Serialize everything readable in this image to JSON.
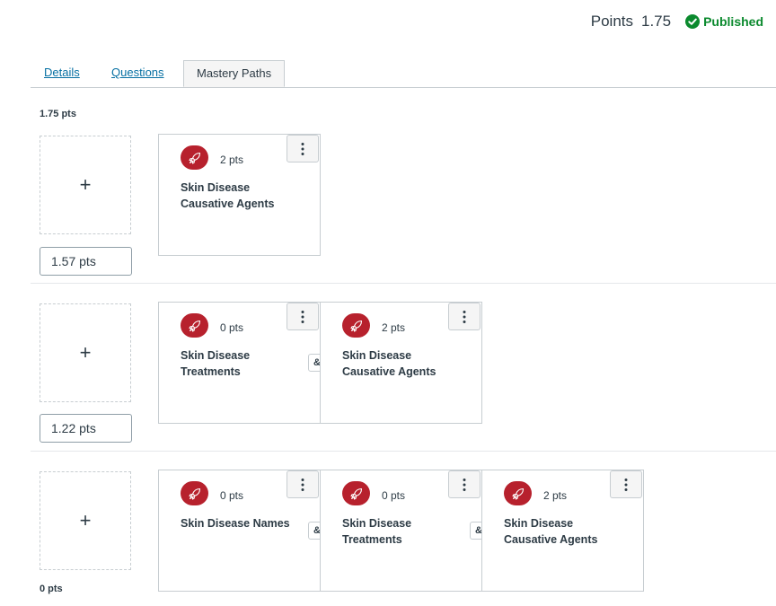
{
  "header": {
    "points_label": "Points",
    "points_value": "1.75",
    "status": "Published"
  },
  "tabs": [
    {
      "label": "Details"
    },
    {
      "label": "Questions"
    },
    {
      "label": "Mastery Paths"
    }
  ],
  "ranges": {
    "top": "1.75 pts",
    "bottom": "0 pts"
  },
  "rows": [
    {
      "add_label": "+",
      "score": "1.57 pts",
      "cards": [
        {
          "pts": "2 pts",
          "title": "Skin Disease Causative Agents"
        }
      ],
      "connector": "&"
    },
    {
      "add_label": "+",
      "score": "1.22 pts",
      "cards": [
        {
          "pts": "0 pts",
          "title": "Skin Disease Treatments"
        },
        {
          "pts": "2 pts",
          "title": "Skin Disease Causative Agents"
        }
      ],
      "connector": "&"
    },
    {
      "add_label": "+",
      "cards": [
        {
          "pts": "0 pts",
          "title": "Skin Disease Names"
        },
        {
          "pts": "0 pts",
          "title": "Skin Disease Treatments"
        },
        {
          "pts": "2 pts",
          "title": "Skin Disease Causative Agents"
        }
      ],
      "connector": "&"
    }
  ],
  "colors": {
    "published": "#0b8a2e",
    "rocket_badge": "#b7212d",
    "link": "#0770a3"
  }
}
